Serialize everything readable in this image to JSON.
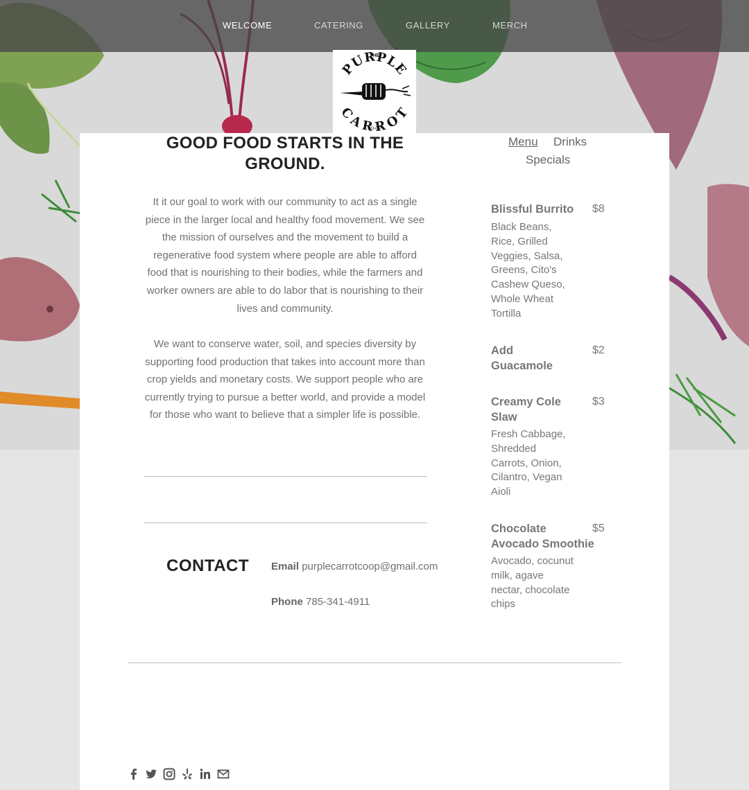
{
  "nav": {
    "items": [
      {
        "label": "WELCOME",
        "active": true
      },
      {
        "label": "CATERING",
        "active": false
      },
      {
        "label": "GALLERY",
        "active": false
      },
      {
        "label": "MERCH",
        "active": false
      }
    ]
  },
  "logo": {
    "small_top": "THE",
    "line1": "PURPLE",
    "line2": "CARROT",
    "small_bottom": "CO-OP"
  },
  "main": {
    "headline": "GOOD FOOD STARTS IN THE GROUND.",
    "paragraph1": "It it our goal to work with our community to act as a single piece in the larger local and healthy food movement. We see the mission of ourselves and the movement to build a regenerative food system where people are able to afford food that is nourishing to their bodies, while the farmers and worker owners are able to do labor that is nourishing to their lives and community.",
    "paragraph2": "We want to conserve water, soil, and species diversity by supporting food production that takes into account more than crop yields and monetary costs. We support people who are currently trying to pursue a better world, and provide a model for those who want to believe that a simpler life is possible."
  },
  "contact": {
    "heading": "CONTACT",
    "email_label": "Email",
    "email": "purplecarrotcoop@gmail.com",
    "phone_label": "Phone",
    "phone": "785-341-4911"
  },
  "menu": {
    "tabs": [
      "Menu",
      "Drinks",
      "Specials"
    ],
    "active_tab": "Menu",
    "items": [
      {
        "name": "Blissful Burrito",
        "price": "$8",
        "desc": "Black Beans, Rice, Grilled Veggies, Salsa, Greens, Cito's Cashew Queso, Whole Wheat Tortilla"
      },
      {
        "name": "Add Guacamole",
        "price": "$2",
        "desc": ""
      },
      {
        "name": "Creamy Cole Slaw",
        "price": "$3",
        "desc": "Fresh Cabbage, Shredded Carrots, Onion, Cilantro, Vegan Aioli"
      },
      {
        "name": "Chocolate Avocado Smoothie",
        "price": "$5",
        "desc": "Avocado, cocunut milk, agave nectar, chocolate chips"
      }
    ]
  },
  "social": [
    "facebook-icon",
    "twitter-icon",
    "instagram-icon",
    "yelp-icon",
    "linkedin-icon",
    "email-icon"
  ],
  "colors": {
    "topbar": "#464646",
    "background": "#e5e5e5",
    "card": "#ffffff",
    "heading": "#222222",
    "body_text": "#707070",
    "beet": "#a8325a",
    "leaf": "#3f8a35"
  }
}
